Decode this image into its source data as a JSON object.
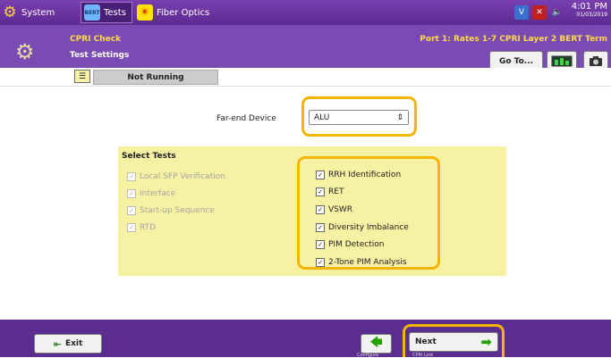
{
  "top_tabs": [
    {
      "label": "System",
      "icon": "gear-icon"
    },
    {
      "label": "Tests",
      "icon": "bert-icon",
      "icon_text": "BERT"
    },
    {
      "label": "Fiber Optics",
      "icon": "starburst-icon"
    }
  ],
  "status_icons": [
    "vnc-icon",
    "close-icon",
    "speaker-icon"
  ],
  "clock": {
    "time": "4:01 PM",
    "date": "01/03/2019"
  },
  "header": {
    "title": "CPRI Check",
    "port": "Port 1: Rates 1-7 CPRI Layer 2 BERT Term",
    "section": "Test Settings",
    "goto_label": "Go To..."
  },
  "status": {
    "text": "Not Running"
  },
  "far_end": {
    "label": "Far-end Device",
    "value": "ALU"
  },
  "select_tests": {
    "heading": "Select Tests",
    "left": [
      {
        "label": "Local SFP Verification",
        "checked": true,
        "enabled": false
      },
      {
        "label": "Interface",
        "checked": true,
        "enabled": false
      },
      {
        "label": "Start-up Sequence",
        "checked": true,
        "enabled": false
      },
      {
        "label": "RTD",
        "checked": true,
        "enabled": false
      }
    ],
    "right": [
      {
        "label": "RRH Identification",
        "checked": true,
        "enabled": true
      },
      {
        "label": "RET",
        "checked": true,
        "enabled": true
      },
      {
        "label": "VSWR",
        "checked": true,
        "enabled": true
      },
      {
        "label": "Diversity Imbalance",
        "checked": true,
        "enabled": true
      },
      {
        "label": "PIM Detection",
        "checked": true,
        "enabled": true
      },
      {
        "label": "2-Tone PIM Analysis",
        "checked": true,
        "enabled": true
      }
    ]
  },
  "footer": {
    "exit_label": "Exit",
    "back_caption": "Configure",
    "next_label": "Next",
    "next_caption": "CPRI Link"
  },
  "colors": {
    "purple": "#5d2a91",
    "highlight": "#f5b400",
    "panel": "#f7f1a3",
    "title_yellow": "#ffd84a"
  }
}
